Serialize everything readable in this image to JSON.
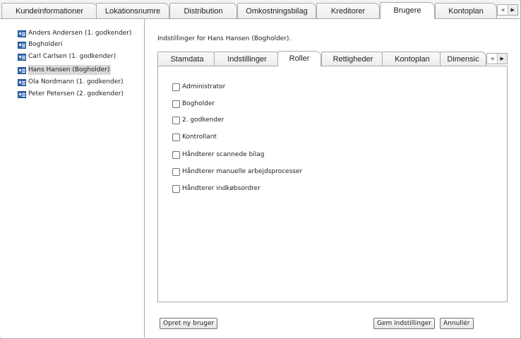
{
  "top_tabs": [
    "Kundeinformationer",
    "Lokationsnumre",
    "Distribution",
    "Omkostningsbilag",
    "Kreditorer",
    "Brugere",
    "Kontoplan"
  ],
  "users": [
    "Anders Andersen (1. godkender)",
    "Bogholderi",
    "Carl Carlsen (1. godkender)",
    "Hans Hansen (Bogholder)",
    "Ola Nordmann (1. godkender)",
    "Peter Petersen (2. godkender)"
  ],
  "heading": "Indstillinger for Hans Hansen (Bogholder).",
  "sub_tabs": [
    "Stamdata",
    "Indstillinger",
    "Roller",
    "Rettigheder",
    "Kontoplan",
    "Dimensic"
  ],
  "roles": [
    "Administrator",
    "Bogholder",
    "2. godkender",
    "Kontrollant",
    "Håndterer scannede bilag",
    "Håndterer manuelle arbejdsprocesser",
    "Håndterer indkøbsordrer"
  ],
  "buttons": {
    "create": "Opret ny bruger",
    "save": "Gem indstillinger",
    "cancel": "Annullér"
  }
}
